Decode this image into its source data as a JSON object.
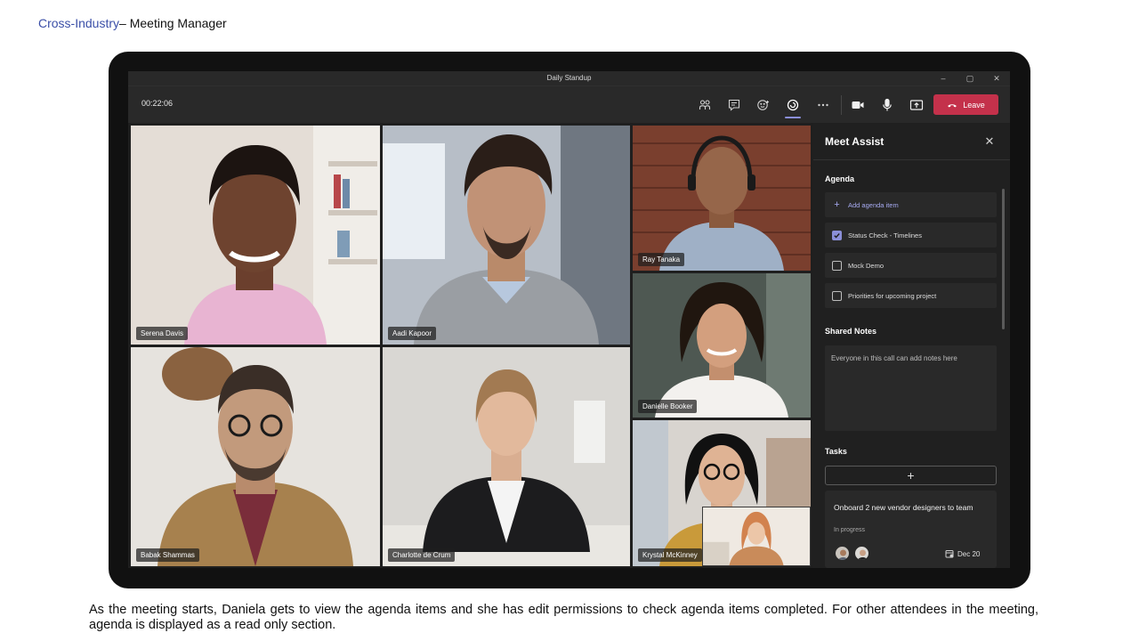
{
  "slide": {
    "category": "Cross-Industry",
    "separator": "– ",
    "title": "Meeting Manager",
    "caption": "As the meeting starts, Daniela gets to view the agenda items and she has edit permissions to check agenda items completed. For other attendees in the meeting, agenda is displayed as a read only section."
  },
  "window": {
    "title": "Daily Standup",
    "minimize_icon": "minimize-icon",
    "maximize_icon": "maximize-icon",
    "close_icon": "close-icon"
  },
  "toolbar": {
    "timer": "00:22:06",
    "buttons": [
      {
        "icon": "people-icon",
        "active": false
      },
      {
        "icon": "chat-icon",
        "active": false
      },
      {
        "icon": "reactions-icon",
        "active": false
      },
      {
        "icon": "apps-icon",
        "active": true
      },
      {
        "icon": "more-icon",
        "active": false
      },
      {
        "icon": "camera-icon",
        "active": false
      },
      {
        "icon": "mic-icon",
        "active": false
      },
      {
        "icon": "share-icon",
        "active": false
      }
    ],
    "leave_label": "Leave",
    "leave_color": "#c4314b",
    "accent_color": "#8b8fd8"
  },
  "participants": [
    {
      "name": "Serena Davis"
    },
    {
      "name": "Aadi Kapoor"
    },
    {
      "name": "Ray Tanaka"
    },
    {
      "name": "Danielle Booker"
    },
    {
      "name": "Babak Shammas"
    },
    {
      "name": "Charlotte de Crum"
    },
    {
      "name": "Krystal McKinney"
    }
  ],
  "panel": {
    "title": "Meet Assist",
    "agenda_title": "Agenda",
    "add_agenda_label": "Add agenda item",
    "agenda_items": [
      {
        "label": "Status Check - Timelines",
        "checked": true
      },
      {
        "label": "Mock Demo",
        "checked": false
      },
      {
        "label": "Priorities for upcoming project",
        "checked": false
      }
    ],
    "notes_title": "Shared Notes",
    "notes_placeholder": "Everyone in this call can add notes here",
    "tasks_title": "Tasks",
    "add_task_label": "+",
    "task": {
      "title": "Onboard 2 new vendor designers to team",
      "status": "In progress",
      "due": "Dec 20"
    }
  }
}
